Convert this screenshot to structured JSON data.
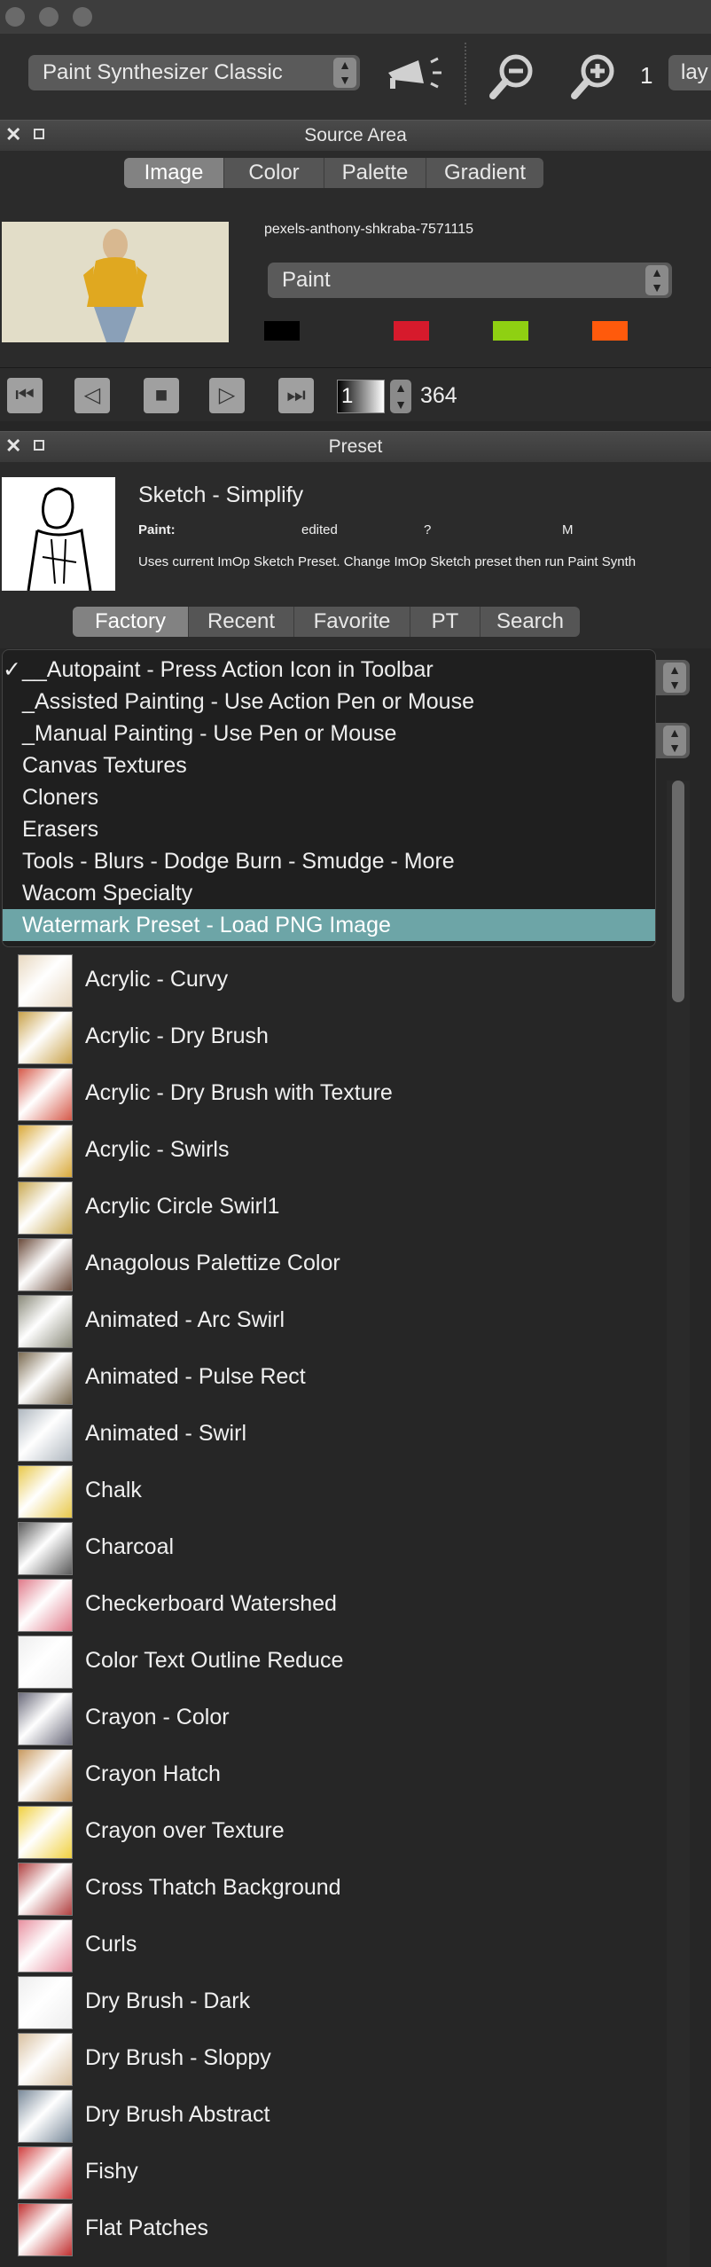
{
  "toolbar": {
    "mode_select": "Paint Synthesizer Classic",
    "zoom_value": "1",
    "layer_label": "lay"
  },
  "source_area": {
    "title": "Source Area",
    "tabs": [
      "Image",
      "Color",
      "Palette",
      "Gradient"
    ],
    "selected_tab": "Image",
    "filename": "pexels-anthony-shkraba-7571115",
    "paint_select": "Paint",
    "swatches": [
      "#000000",
      "#d61a2c",
      "#8fd012",
      "#ff5a0c"
    ],
    "frame_field": "1",
    "frame_count": "364"
  },
  "preset": {
    "title": "Preset",
    "name": "Sketch - Simplify",
    "paint_label": "Paint:",
    "paint_value": "edited",
    "question": "?",
    "m_label": "M",
    "description": "Uses current ImOp Sketch Preset.  Change ImOp Sketch preset then run Paint Synth",
    "tabs": [
      "Factory",
      "Recent",
      "Favorite",
      "PT",
      "Search"
    ],
    "selected_tab": "Factory"
  },
  "category_menu": {
    "checkmark": "✓",
    "items": [
      "__Autopaint - Press Action Icon in Toolbar",
      "_Assisted Painting - Use Action Pen or Mouse",
      "_Manual Painting - Use Pen or Mouse",
      "Canvas Textures",
      "Cloners",
      "Erasers",
      "Tools - Blurs - Dodge Burn - Smudge - More",
      "Wacom Specialty",
      "Watermark Preset - Load PNG Image"
    ],
    "checked_index": 0,
    "highlighted_index": 8
  },
  "preset_list": [
    "Acrylic - Curvy",
    "Acrylic - Dry Brush",
    "Acrylic - Dry Brush with Texture",
    "Acrylic - Swirls",
    "Acrylic Circle  Swirl1",
    "Anagolous Palettize Color",
    "Animated - Arc Swirl",
    "Animated - Pulse Rect",
    "Animated - Swirl",
    "Chalk",
    "Charcoal",
    "Checkerboard Watershed",
    "Color Text Outline Reduce",
    "Crayon - Color",
    "Crayon Hatch",
    "Crayon over Texture",
    "Cross Thatch Background",
    "Curls",
    "Dry Brush - Dark",
    "Dry Brush - Sloppy",
    "Dry Brush Abstract",
    "Fishy",
    "Flat Patches"
  ],
  "thumb_colors": [
    "#e8d8c0",
    "#c9a24a",
    "#d65a4a",
    "#d9a93a",
    "#c8a850",
    "#6a4a3a",
    "#8a8a7a",
    "#7a6a50",
    "#b0b8c0",
    "#e8c84a",
    "#5a5a5a",
    "#e07a8a",
    "#eeeeee",
    "#6a6a7a",
    "#c89a60",
    "#f0d040",
    "#b04040",
    "#e890a0",
    "#eeeeee",
    "#d8c0a0",
    "#7a8a9a",
    "#d04040",
    "#c03030"
  ],
  "icons": {
    "megaphone": "megaphone-icon",
    "zoom_out": "zoom-out-icon",
    "zoom_in": "zoom-in-icon"
  }
}
